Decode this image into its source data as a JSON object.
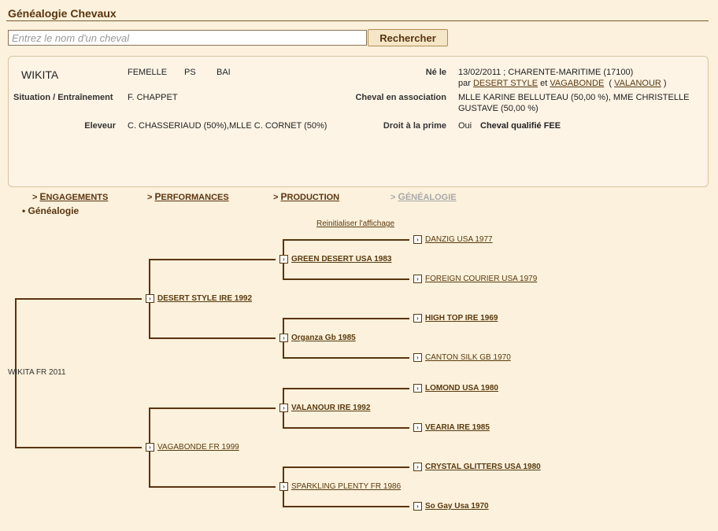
{
  "page": {
    "title": "Généalogie Chevaux"
  },
  "search": {
    "placeholder": "Entrez le nom d'un cheval",
    "button_label": "Rechercher"
  },
  "horse": {
    "name": "WIKITA",
    "sex": "FEMELLE",
    "breed": "PS",
    "color": "BAI",
    "born_label": "Né le",
    "born_value": "13/02/2011 ; CHARENTE-MARITIME (17100)",
    "par_label": "par",
    "sire": "DESERT STYLE",
    "et_label": "et",
    "dam": "VAGABONDE",
    "damsire_open": "(",
    "damsire": "VALANOUR",
    "damsire_close": ")",
    "situation_label": "Situation / Entraînement",
    "situation_value": "F. CHAPPET",
    "association_label": "Cheval en association",
    "association_line1": "MLLE KARINE BELLUTEAU (50,00 %), MME CHRISTELLE",
    "association_line2": "GUSTAVE (50,00 %)",
    "breeder_label": "Eleveur",
    "breeder_value": "C. CHASSERIAUD (50%),MLLE C. CORNET (50%)",
    "prize_label": "Droit à la prime",
    "prize_value": "Oui",
    "qualified": "Cheval qualifié FEE"
  },
  "tabs": [
    {
      "first": "E",
      "rest": "NGAGEMENTS"
    },
    {
      "first": "P",
      "rest": "ERFORMANCES"
    },
    {
      "first": "P",
      "rest": "RODUCTION"
    },
    {
      "first": "G",
      "rest": "ÉNÉALOGIE"
    }
  ],
  "tab_prefix": ">",
  "subnav": "• Généalogie",
  "reset_label": "Reinitialiser l'affichage",
  "pedigree": {
    "root": "WIKITA FR 2011",
    "sire": "DESERT STYLE IRE 1992",
    "dam": "VAGABONDE FR 1999",
    "ss": "GREEN DESERT USA 1983",
    "sd": "Organza Gb 1985",
    "ds": "VALANOUR IRE 1992",
    "dd": "SPARKLING PLENTY FR 1986",
    "sss": "DANZIG USA 1977",
    "ssd": "FOREIGN COURIER USA 1979",
    "sds": "HIGH TOP IRE 1969",
    "sdd": "CANTON SILK GB 1970",
    "dss": "LOMOND USA 1980",
    "dsd": "VEARIA IRE 1985",
    "dds": "CRYSTAL GLITTERS USA 1980",
    "ddd": "So Gay Usa 1970"
  },
  "colors": {
    "accent": "#5a3410",
    "background": "#fbf1dc",
    "card": "#fdf4e6"
  }
}
